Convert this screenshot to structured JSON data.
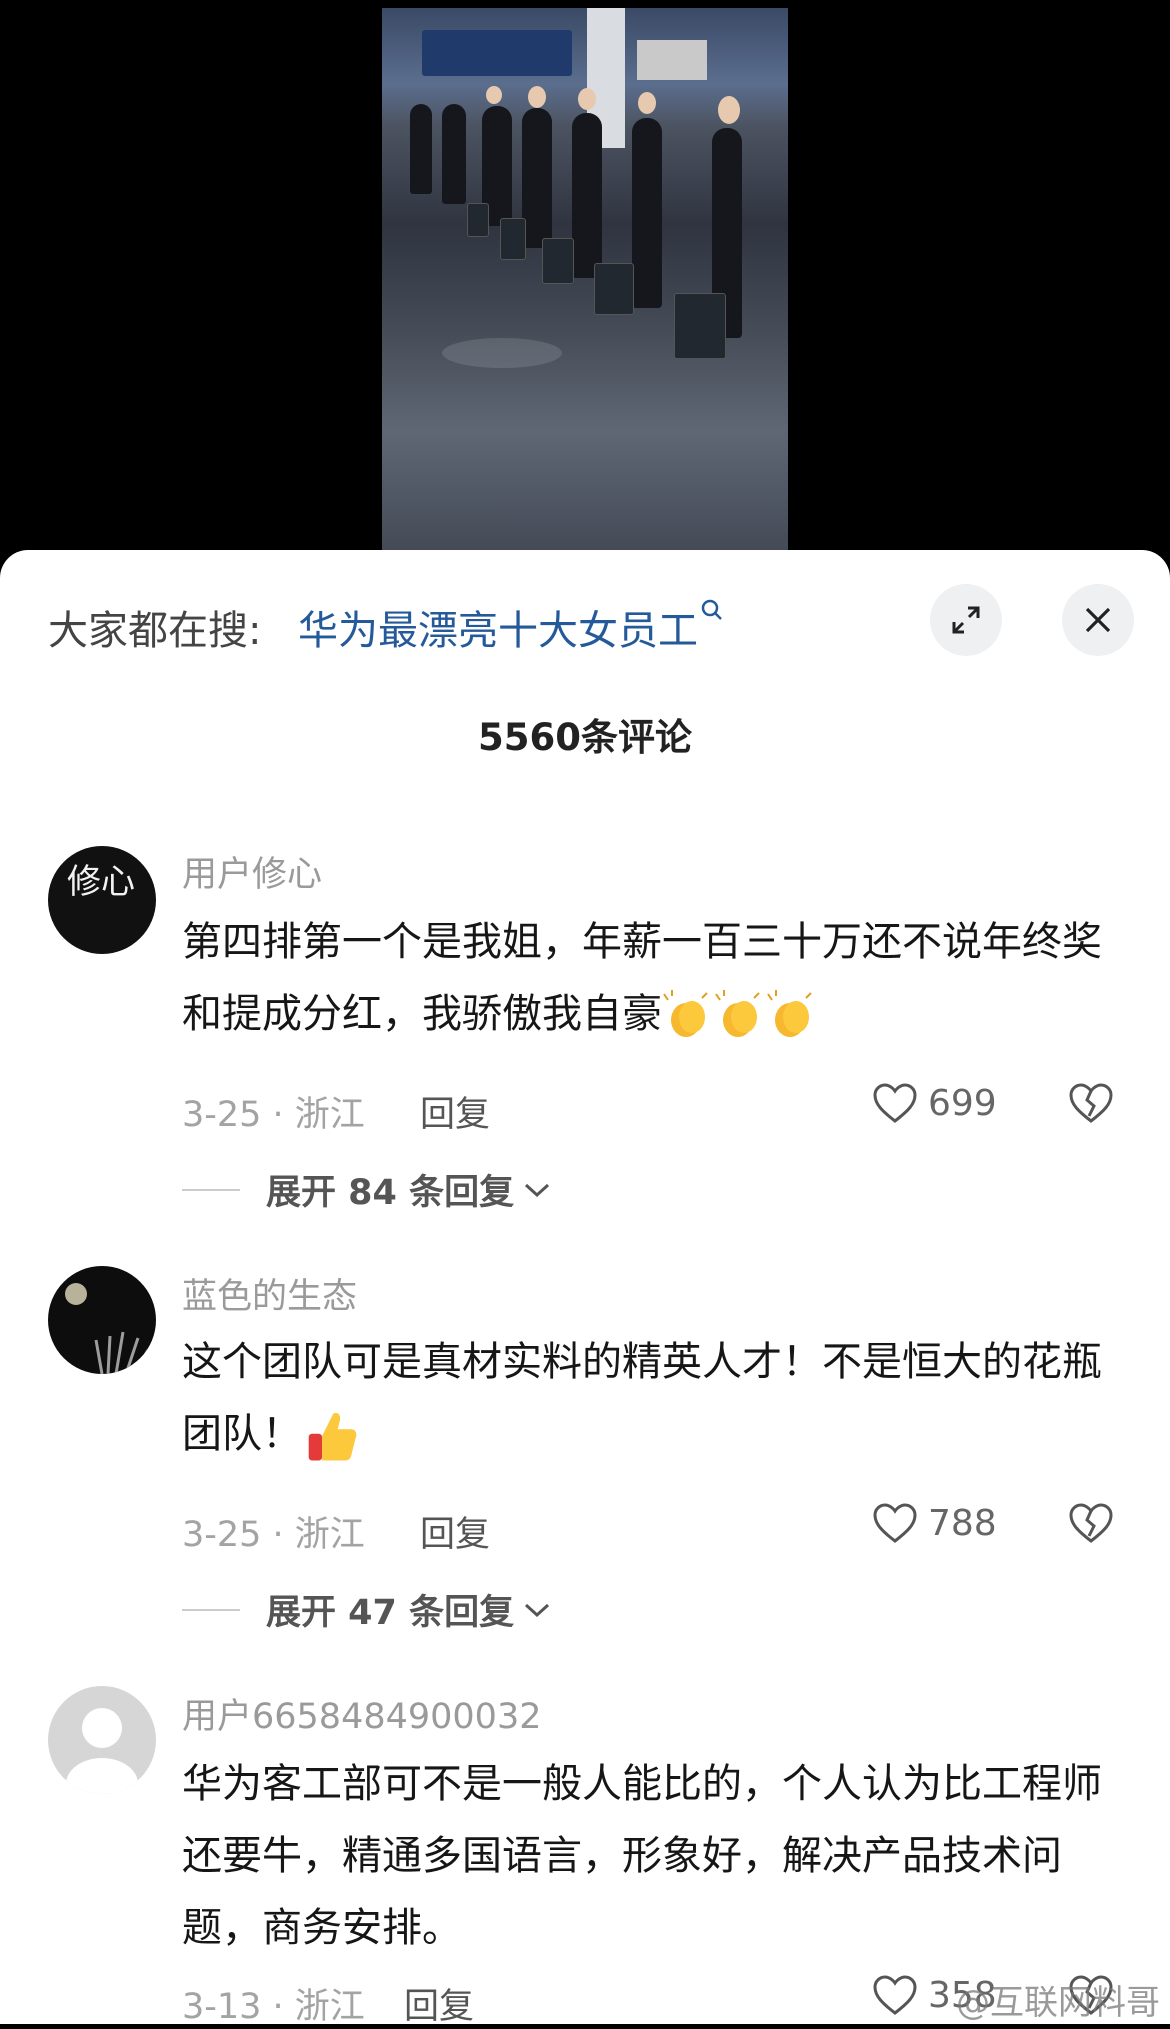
{
  "header": {
    "hot_search_label": "大家都在搜:",
    "hot_search_link": "华为最漂亮十大女员工",
    "comment_count": "5560条评论"
  },
  "comments": [
    {
      "user": "用户修心",
      "text": "第四排第一个是我姐，年薪一百三十万还不说年终奖和提成分红，我骄傲我自豪",
      "date_loc": "3-25 · 浙江",
      "reply_label": "回复",
      "likes": "699",
      "expand_label": "展开 84 条回复"
    },
    {
      "user": "蓝色的生态",
      "text": "这个团队可是真材实料的精英人才！不是恒大的花瓶团队！",
      "date_loc": "3-25 · 浙江",
      "reply_label": "回复",
      "likes": "788",
      "expand_label": "展开 47 条回复"
    },
    {
      "user": "用户6658484900032",
      "text": "华为客工部可不是一般人能比的，个人认为比工程师还要牛，精通多国语言，形象好，解决产品技术问题，商务安排。",
      "date_loc": "3-13 · 浙江",
      "reply_label": "回复",
      "likes": "358"
    }
  ],
  "avatar1_text": "修心",
  "watermark": "@互联网料哥",
  "colors": {
    "link": "#255a9a",
    "sheet": "#ffffff",
    "backdrop": "#000000"
  }
}
